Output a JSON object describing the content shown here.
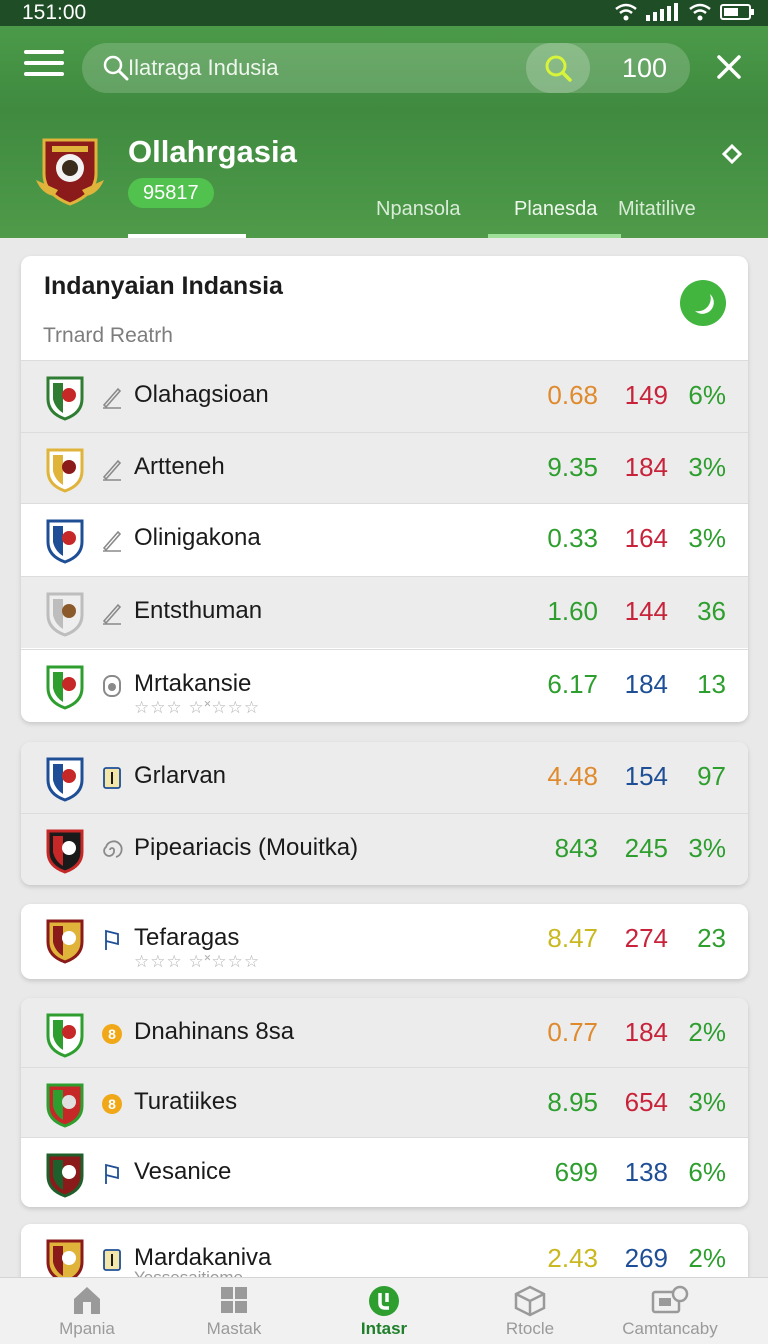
{
  "status_bar": {
    "time": "151:00"
  },
  "header": {
    "search_placeholder": "Ilatraga Indusia",
    "result_count": "100"
  },
  "league": {
    "name": "Ollahrgasia",
    "badge": "95817",
    "tabs": [
      "Npansola",
      "Planesda",
      "Mitatilive"
    ]
  },
  "card": {
    "title": "Indanyaian Indansia",
    "subtitle": "Trnard Reatrh"
  },
  "colors": {
    "green": "#2e9e2f",
    "red": "#c8233a",
    "orange": "#e08a2e",
    "blue": "#1e4f96",
    "yellow": "#c9b81f",
    "brand": "#3f8a3f"
  },
  "rows": [
    {
      "name": "Olahagsioan",
      "v1": "0.68",
      "v2": "149",
      "v3": "6%",
      "c1": "#e08a2e",
      "c2": "#c8233a",
      "c3": "#2e9e2f"
    },
    {
      "name": "Artteneh",
      "v1": "9.35",
      "v2": "184",
      "v3": "3%",
      "c1": "#2e9e2f",
      "c2": "#c8233a",
      "c3": "#2e9e2f"
    },
    {
      "name": "Olinigakona",
      "v1": "0.33",
      "v2": "164",
      "v3": "3%",
      "c1": "#2e9e2f",
      "c2": "#c8233a",
      "c3": "#2e9e2f"
    },
    {
      "name": "Entsthuman",
      "v1": "1.60",
      "v2": "144",
      "v3": "36",
      "c1": "#2e9e2f",
      "c2": "#c8233a",
      "c3": "#2e9e2f"
    },
    {
      "name": "Mrtakansie",
      "v1": "6.17",
      "v2": "184",
      "v3": "13",
      "c1": "#2e9e2f",
      "c2": "#1e4f96",
      "c3": "#2e9e2f",
      "stars": "☆☆☆ ☆˟☆☆☆"
    },
    {
      "name": "Grlarvan",
      "v1": "4.48",
      "v2": "154",
      "v3": "97",
      "c1": "#e08a2e",
      "c2": "#1e4f96",
      "c3": "#2e9e2f"
    },
    {
      "name": "Pipeariacis (Mouitka)",
      "v1": "843",
      "v2": "245",
      "v3": "3%",
      "c1": "#2e9e2f",
      "c2": "#2e9e2f",
      "c3": "#2e9e2f"
    },
    {
      "name": "Tefaragas",
      "v1": "8.47",
      "v2": "274",
      "v3": "23",
      "c1": "#c9b81f",
      "c2": "#c8233a",
      "c3": "#2e9e2f",
      "stars": "☆☆☆ ☆˟☆☆☆"
    },
    {
      "name": "Dnahinans 8sa",
      "v1": "0.77",
      "v2": "184",
      "v3": "2%",
      "c1": "#e08a2e",
      "c2": "#c8233a",
      "c3": "#2e9e2f"
    },
    {
      "name": "Turatiikes",
      "v1": "8.95",
      "v2": "654",
      "v3": "3%",
      "c1": "#2e9e2f",
      "c2": "#c8233a",
      "c3": "#2e9e2f"
    },
    {
      "name": "Vesanice",
      "v1": "699",
      "v2": "138",
      "v3": "6%",
      "c1": "#2e9e2f",
      "c2": "#1e4f96",
      "c3": "#2e9e2f"
    },
    {
      "name": "Mardakaniva",
      "v1": "2.43",
      "v2": "269",
      "v3": "2%",
      "c1": "#c9b81f",
      "c2": "#1e4f96",
      "c3": "#2e9e2f",
      "sub": "Yessesaitiome"
    }
  ],
  "bottom_nav": [
    {
      "label": "Mpania",
      "icon": "home-icon"
    },
    {
      "label": "Mastak",
      "icon": "grid-icon"
    },
    {
      "label": "Intasr",
      "icon": "score-icon",
      "active": true
    },
    {
      "label": "Rtocle",
      "icon": "cube-icon"
    },
    {
      "label": "Camtancaby",
      "icon": "camera-icon"
    }
  ]
}
